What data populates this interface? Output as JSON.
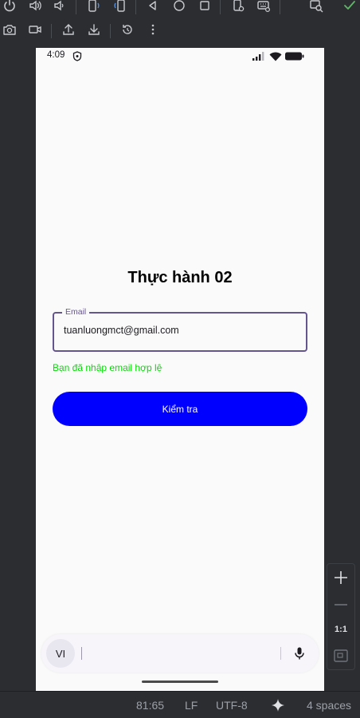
{
  "toolbar": {
    "row1_icons": [
      "power-icon",
      "volume-up-icon",
      "volume-down-icon",
      "rotate-left-icon",
      "rotate-right-icon",
      "back-icon",
      "home-icon",
      "overview-icon",
      "device-settings-icon",
      "keyboard-settings-icon",
      "snapshot-search-icon",
      "check-icon"
    ],
    "row2_icons": [
      "camera-icon",
      "video-icon",
      "upload-icon",
      "download-icon",
      "reset-icon",
      "more-icon"
    ]
  },
  "status_bar": {
    "time": "4:09"
  },
  "app": {
    "title": "Thực hành 02",
    "email_label": "Email",
    "email_value": "tuanluongmct@gmail.com",
    "validation_message": "Bạn đã nhập email hợp lệ",
    "validation_color": "#00e000",
    "button_label": "Kiểm tra",
    "button_color": "#0000ff",
    "accent_color": "#65558f"
  },
  "keyboard": {
    "language": "VI"
  },
  "zoom_controls": {
    "reset_label": "1:1"
  },
  "ide_status": {
    "position": "81:65",
    "line_ending": "LF",
    "encoding": "UTF-8",
    "indent": "4 spaces"
  }
}
